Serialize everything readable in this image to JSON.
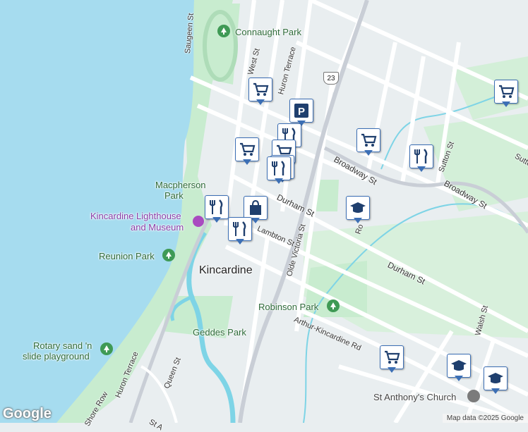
{
  "map": {
    "labels": {
      "connaught_park": "Connaught Park",
      "macpherson_park_1": "Macpherson",
      "macpherson_park_2": "Park",
      "lighthouse_1": "Kincardine Lighthouse",
      "lighthouse_2": "and Museum",
      "reunion_park": "Reunion Park",
      "kincardine": "Kincardine",
      "robinson_park": "Robinson Park",
      "geddes_park": "Geddes Park",
      "rotary_1": "Rotary sand 'n",
      "rotary_2": "slide playground",
      "st_anthony": "St Anthony's Church"
    },
    "streets": {
      "saugeen": "Saugeen St",
      "west": "West St",
      "huron_terrace_n": "Huron Terrace",
      "broadway_1": "Broadway St",
      "broadway_2": "Broadway St",
      "sutton": "Sutton St",
      "sutton_2": "Sutton",
      "durham_1": "Durham St",
      "durham_2": "Durham St",
      "lambton": "Lambton St",
      "olde_victoria": "Olde Victoria St",
      "arthur_kincardine": "Arthur-Kincardine Rd",
      "walsh": "Walsh St",
      "queen": "Queen St",
      "huron_terrace_s": "Huron Terrace",
      "shore_row": "Shore Row",
      "st_a": "St A",
      "ro": "Ro"
    },
    "route_shield": "23",
    "pins": [
      {
        "icon": "shopping-cart-icon"
      },
      {
        "icon": "parking-icon"
      },
      {
        "icon": "restaurant-icon"
      },
      {
        "icon": "shopping-cart-icon"
      },
      {
        "icon": "restaurant-icon"
      },
      {
        "icon": "shopping-cart-icon"
      },
      {
        "icon": "restaurant-icon"
      },
      {
        "icon": "shopping-bag-icon"
      },
      {
        "icon": "restaurant-icon"
      },
      {
        "icon": "restaurant-icon"
      },
      {
        "icon": "shopping-cart-icon"
      },
      {
        "icon": "restaurant-icon"
      },
      {
        "icon": "school-icon"
      },
      {
        "icon": "shopping-cart-icon"
      },
      {
        "icon": "shopping-cart-icon"
      },
      {
        "icon": "school-icon"
      },
      {
        "icon": "school-icon"
      }
    ],
    "colors": {
      "water": "#a6dcef",
      "land": "#e9eef0",
      "park": "#c8eccf",
      "road": "#ffffff",
      "highway": "#c9ced6",
      "river": "#7ed4e6",
      "pin_border": "#3c6fb5",
      "pin_icon": "#1f3f6e"
    }
  },
  "branding": {
    "logo": "Google",
    "attribution": "Map data ©2025 Google"
  }
}
